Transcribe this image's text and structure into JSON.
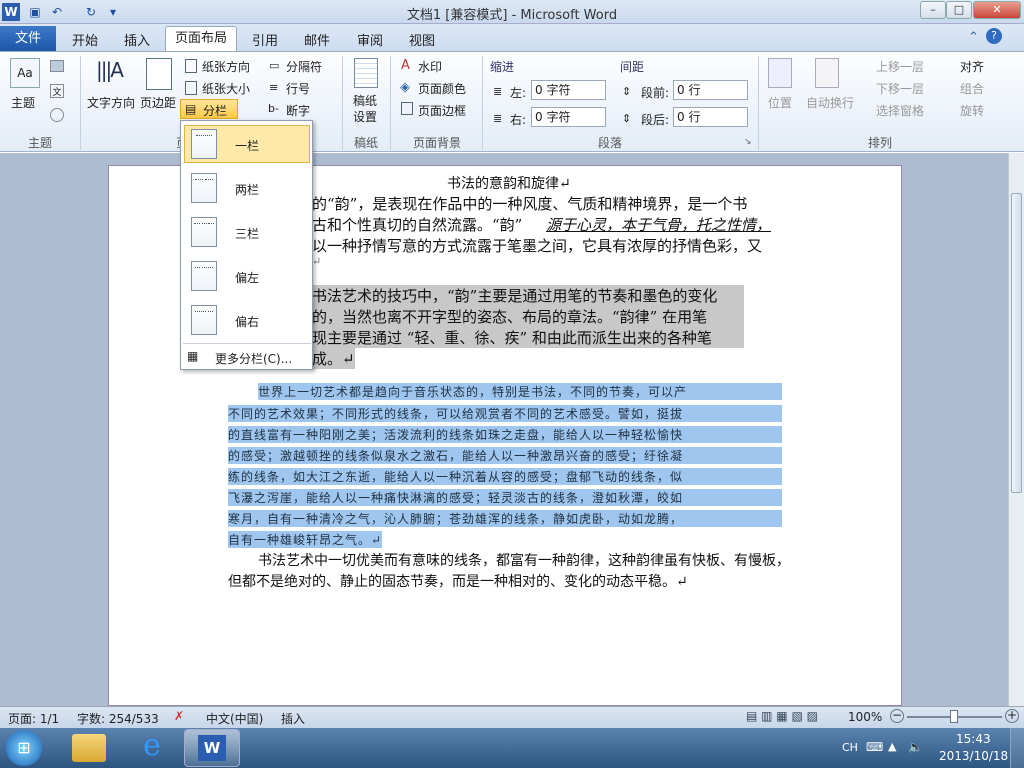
{
  "title": "文档1 [兼容模式] - Microsoft Word",
  "tabs": {
    "file": "文件",
    "home": "开始",
    "insert": "插入",
    "layout": "页面布局",
    "refs": "引用",
    "mail": "邮件",
    "review": "审阅",
    "view": "视图"
  },
  "ribbon": {
    "theme_group": "主题",
    "theme_btn": "主题",
    "text_direction": "文字方向",
    "margins": "页边距",
    "orientation": "纸张方向",
    "size": "纸张大小",
    "columns": "分栏",
    "breaks": "分隔符",
    "line_numbers": "行号",
    "hyphenation": "断字",
    "draft_paper": "稿纸\n设置",
    "draft_group": "稿纸",
    "watermark": "水印",
    "page_color": "页面颜色",
    "page_border": "页面边框",
    "bg_group": "页面背景",
    "indent": "缩进",
    "left": "左:",
    "right": "右:",
    "indent_left_val": "0 字符",
    "indent_right_val": "0 字符",
    "spacing": "间距",
    "before": "段前:",
    "after": "段后:",
    "before_val": "0 行",
    "after_val": "0 行",
    "para_group": "段落",
    "position": "位置",
    "wrap": "自动换行",
    "bring_forward": "上移一层",
    "send_backward": "下移一层",
    "selection_pane": "选择窗格",
    "align": "对齐",
    "group": "组合",
    "rotate": "旋转",
    "arrange_group": "排列",
    "p_group_partial": "页"
  },
  "columns_menu": {
    "one": "一栏",
    "two": "两栏",
    "three": "三栏",
    "left": "偏左",
    "right": "偏右",
    "more": "更多分栏(C)..."
  },
  "doc": {
    "title": "书法的意韵和旋律↵",
    "p1_l1": "的“韵”，是表现在作品中的一种风度、气质和精神境界，是一个书",
    "p1_l2a": "古和个性真切的自然流露。“韵”",
    "p1_l2b": "源于心灵，本于气骨，托之性情，",
    "p1_l3": "以一种抒情写意的方式流露于笔墨之间，它具有浓厚的抒情色彩，又",
    "p1_l4": "↵",
    "p2_l1": "书法艺术的技巧中，“韵”主要是通过用笔的节奏和墨色的变化",
    "p2_l2": "的，当然也离不开字型的姿态、布局的章法。“韵律” 在用笔",
    "p2_l3": "现主要是通过 “轻、重、徐、疾” 和由此而派生出来的各种笔",
    "p2_l4": "成。↵",
    "p3_l1": "世界上一切艺术都是趋向于音乐状态的，特别是书法，不同的节奏，可以产",
    "p3_l2": "不同的艺术效果；不同形式的线条，可以给观赏者不同的艺术感受。譬如，挺拔",
    "p3_l3": "的直线富有一种阳刚之美；活泼流利的线条如珠之走盘，能给人以一种轻松愉快",
    "p3_l4": "的感受；激越顿挫的线条似泉水之激石，能给人以一种激昂兴奋的感受；纡徐凝",
    "p3_l5": "练的线条，如大江之东逝，能给人以一种沉着从容的感受；盘郁飞动的线条，似",
    "p3_l6": "飞瀑之泻崖，能给人以一种痛快淋漓的感受；轻灵淡古的线条，澄如秋潭，皎如",
    "p3_l7": "寒月，自有一种清冷之气，沁人肺腑；苍劲雄浑的线条，静如虎卧，动如龙腾，",
    "p3_l8": "自有一种雄峻轩昂之气。↵",
    "p4_l1": "书法艺术中一切优美而有意味的线条，都富有一种韵律，这种韵律虽有快板、有慢板，",
    "p4_l2": "但都不是绝对的、静止的固态节奏，而是一种相对的、变化的动态平稳。↵"
  },
  "status": {
    "page": "页面: 1/1",
    "words": "字数: 254/533",
    "lang": "中文(中国)",
    "mode": "插入",
    "zoom": "100%"
  },
  "taskbar": {
    "ime": "CH",
    "time": "15:43",
    "date": "2013/10/18"
  }
}
